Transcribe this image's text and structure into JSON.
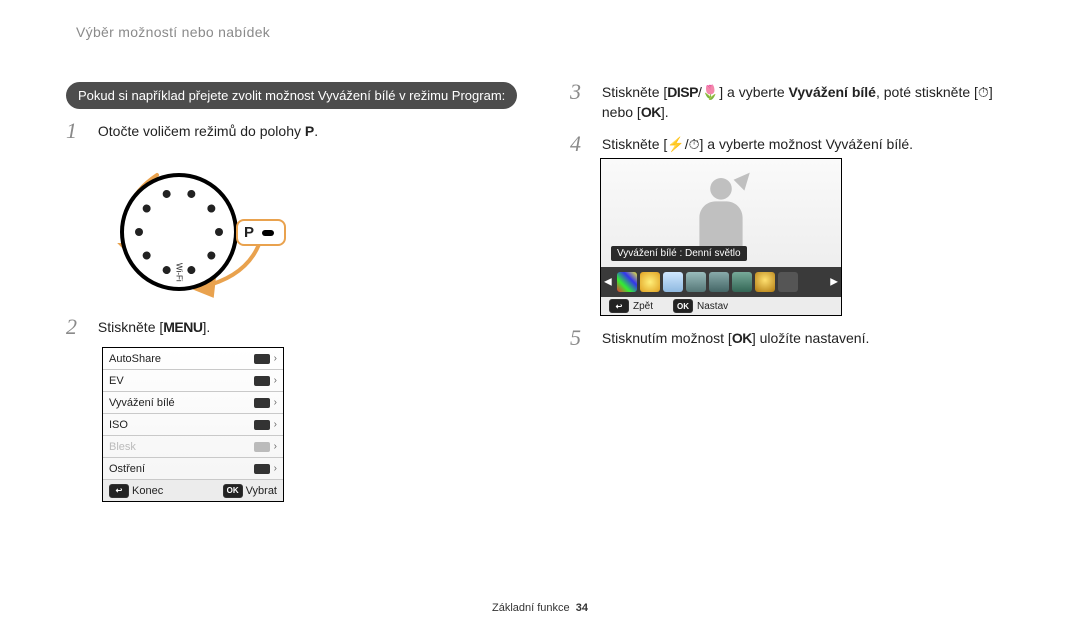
{
  "breadcrumb": "Výběr možností nebo nabídek",
  "callout": "Pokud si například přejete zvolit možnost Vyvážení bílé v režimu Program:",
  "steps": {
    "s1_pre": "Otočte voličem režimů do polohy ",
    "s1_mode": "P",
    "s1_post": ".",
    "s2_pre": "Stiskněte [",
    "s2_key": "MENU",
    "s2_post": "].",
    "s3_pre": "Stiskněte [",
    "s3_key1": "DISP",
    "s3_sep": "/",
    "s3_key2": "🌷",
    "s3_mid": "] a vyberte ",
    "s3_bold": "Vyvážení bílé",
    "s3_after": ", poté stiskněte [",
    "s3_key3": "⏱",
    "s3_or": "] nebo [",
    "s3_key4": "OK",
    "s3_end": "].",
    "s4_pre": "Stiskněte [",
    "s4_key1": "⚡",
    "s4_sep": "/",
    "s4_key2": "⏱",
    "s4_post": "] a vyberte možnost Vyvážení bílé.",
    "s5_pre": "Stisknutím možnost [",
    "s5_key": "OK",
    "s5_post": "] uložíte nastavení."
  },
  "dial": {
    "indicator_label": "P",
    "wifi_label": "Wi-Fi"
  },
  "menu": {
    "rows": [
      {
        "label": "AutoShare",
        "disabled": false
      },
      {
        "label": "EV",
        "disabled": false
      },
      {
        "label": "Vyvážení bílé",
        "disabled": false
      },
      {
        "label": "ISO",
        "disabled": false
      },
      {
        "label": "Blesk",
        "disabled": true
      },
      {
        "label": "Ostření",
        "disabled": false
      }
    ],
    "bar": {
      "back_key": "↩",
      "back_label": "Konec",
      "ok_key": "OK",
      "ok_label": "Vybrat"
    }
  },
  "shot": {
    "tag": "Vyvážení bílé : Denní světlo",
    "bar": {
      "back_key": "↩",
      "back_label": "Zpět",
      "ok_key": "OK",
      "ok_label": "Nastav"
    }
  },
  "footer": {
    "section": "Základní funkce",
    "page": "34"
  }
}
